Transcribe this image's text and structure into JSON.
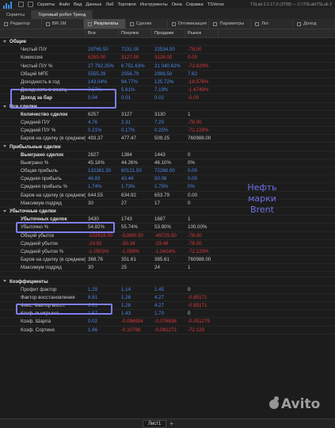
{
  "titlebar": {
    "menu": [
      "Скрипты",
      "Файл",
      "Вид",
      "Данные",
      "Лаб",
      "Торговля",
      "Инструменты",
      "Окна",
      "Справка"
    ],
    "account": "TSVerse",
    "right_text": "TSLab 2.2.17.0 (3708) — C:\\TSLab\\TSLab 2"
  },
  "tabs_top": [
    {
      "label": "Скрипты",
      "active": false
    },
    {
      "label": "Торговый робот Тренд",
      "active": true
    }
  ],
  "tabs_sub": [
    "Редактор",
    "BR:1M",
    "Результаты",
    "Сделки",
    "Оптимизация",
    "Параметры",
    "Лог",
    "Доход"
  ],
  "columns": [
    "",
    "Все",
    "Покупки",
    "Продажи",
    "Рынок"
  ],
  "rows": [
    {
      "t": "section",
      "label": "Общие"
    },
    {
      "t": "row",
      "label": "Чистый П/У",
      "v": [
        "29765.50",
        "7231.00",
        "22534.50",
        "-78.00"
      ],
      "cls": [
        "blue",
        "blue",
        "blue",
        "red"
      ]
    },
    {
      "t": "row",
      "label": "Комиссия",
      "v": [
        "6255.00",
        "3127.00",
        "3128.00",
        "0.00"
      ],
      "cls": [
        "red",
        "red",
        "red",
        "red"
      ]
    },
    {
      "t": "row",
      "label": "Чистый П/У %",
      "v": [
        "27 792.25%",
        "6 751.63%",
        "21 040.62%",
        "-72.829%"
      ],
      "cls": [
        "blue",
        "blue",
        "blue",
        "red"
      ]
    },
    {
      "t": "row",
      "label": "Общий MFE",
      "v": [
        "5555.29",
        "2556.79",
        "2998.50",
        "7.62"
      ],
      "cls": [
        "blue",
        "blue",
        "blue",
        "blue"
      ]
    },
    {
      "t": "row",
      "label": "Доходность в год",
      "v": [
        "143.04%",
        "94.77%",
        "125.72%",
        "-18.576%"
      ],
      "cls": [
        "blue",
        "blue",
        "blue",
        "red"
      ]
    },
    {
      "t": "row",
      "label": "Доходность в месяц",
      "v": [
        "7.57%",
        "5.61%",
        "7.19%",
        "-1.6749%"
      ],
      "cls": [
        "blue",
        "blue",
        "blue",
        "red"
      ]
    },
    {
      "t": "bold",
      "label": "Доход за бар",
      "v": [
        "0.04",
        "0.01",
        "0.02",
        "-0.00"
      ],
      "cls": [
        "blue",
        "blue",
        "blue",
        "red"
      ]
    },
    {
      "t": "section",
      "label": "Все сделки"
    },
    {
      "t": "bold",
      "label": "Количество сделок",
      "v": [
        "6257",
        "3127",
        "3130",
        "1"
      ],
      "cls": [
        "",
        "",
        "",
        ""
      ]
    },
    {
      "t": "row",
      "label": "Средний П/У",
      "v": [
        "4.76",
        "2.31",
        "7.20",
        "-78.00"
      ],
      "cls": [
        "blue",
        "blue",
        "blue",
        "red"
      ]
    },
    {
      "t": "row",
      "label": "Средний П/У %",
      "v": [
        "0.21%",
        "0.17%",
        "0.25%",
        "-72.129%"
      ],
      "cls": [
        "blue",
        "blue",
        "blue",
        "red"
      ]
    },
    {
      "t": "row",
      "label": "Баров на сделку (в среднем)",
      "v": [
        "493.37",
        "477.47",
        "509.25",
        "760988.00"
      ],
      "cls": [
        "",
        "",
        "",
        ""
      ]
    },
    {
      "t": "section",
      "label": "Прибыльные сделки"
    },
    {
      "t": "bold",
      "label": "Выиграно сделок",
      "v": [
        "2827",
        "1384",
        "1443",
        "0"
      ],
      "cls": [
        "",
        "",
        "",
        ""
      ]
    },
    {
      "t": "row",
      "label": "Выиграно %",
      "v": [
        "45.18%",
        "44.26%",
        "46.10%",
        "0%"
      ],
      "cls": [
        "",
        "",
        "",
        ""
      ]
    },
    {
      "t": "row",
      "label": "Общая прибыль",
      "v": [
        "132381.50",
        "60121.50",
        "72260.00",
        "0.00"
      ],
      "cls": [
        "blue",
        "blue",
        "blue",
        "blue"
      ]
    },
    {
      "t": "row",
      "label": "Средняя прибыль",
      "v": [
        "46.83",
        "43.44",
        "50.08",
        "0.00"
      ],
      "cls": [
        "blue",
        "blue",
        "blue",
        "blue"
      ]
    },
    {
      "t": "row",
      "label": "Средняя прибыль %",
      "v": [
        "1.74%",
        "1.73%",
        "1.75%",
        "0%"
      ],
      "cls": [
        "blue",
        "blue",
        "blue",
        "blue"
      ]
    },
    {
      "t": "row",
      "label": "Баров на сделку (в среднем)",
      "v": [
        "644.55",
        "634.92",
        "653.79",
        "0.00"
      ],
      "cls": [
        "",
        "",
        "",
        ""
      ]
    },
    {
      "t": "row",
      "label": "Максимум подряд",
      "v": [
        "30",
        "27",
        "17",
        "0"
      ],
      "cls": [
        "",
        "",
        "",
        ""
      ]
    },
    {
      "t": "section",
      "label": "Убыточные сделки"
    },
    {
      "t": "bold",
      "label": "Убыточных сделок",
      "v": [
        "3430",
        "1743",
        "1687",
        "1"
      ],
      "cls": [
        "",
        "",
        "",
        ""
      ]
    },
    {
      "t": "row",
      "label": "Убыточно %",
      "v": [
        "54.82%",
        "55.74%",
        "53.90%",
        "100.00%"
      ],
      "cls": [
        "",
        "",
        "",
        ""
      ]
    },
    {
      "t": "row",
      "label": "Общий убыток",
      "v": [
        "-102616.00",
        "-52890.50",
        "-49725.50",
        "-78.00"
      ],
      "cls": [
        "red",
        "red",
        "red",
        "red"
      ]
    },
    {
      "t": "row",
      "label": "Средний убыток",
      "v": [
        "-29.92",
        "-30.34",
        "-29.48",
        "-78.00"
      ],
      "cls": [
        "red",
        "red",
        "red",
        "red"
      ]
    },
    {
      "t": "row",
      "label": "Средний убыток %",
      "v": [
        "-1.0503%",
        "-1.059%",
        "-1.0414%",
        "-72.129%"
      ],
      "cls": [
        "red",
        "red",
        "red",
        "red"
      ]
    },
    {
      "t": "row",
      "label": "Баров на сделку (в среднем)",
      "v": [
        "368.76",
        "351.61",
        "385.61",
        "760988.00"
      ],
      "cls": [
        "",
        "",
        "",
        ""
      ]
    },
    {
      "t": "row",
      "label": "Максимум подряд",
      "v": [
        "30",
        "25",
        "24",
        "1"
      ],
      "cls": [
        "",
        "",
        "",
        ""
      ]
    },
    {
      "t": "gap"
    },
    {
      "t": "section",
      "label": "Коэффициенты"
    },
    {
      "t": "row",
      "label": "Профит фактор",
      "v": [
        "1.29",
        "1.14",
        "1.45",
        "0"
      ],
      "cls": [
        "blue",
        "blue",
        "blue",
        ""
      ]
    },
    {
      "t": "row",
      "label": "Фактор восстановления",
      "v": [
        "8.81",
        "1.28",
        "4.27",
        "-0.85171"
      ],
      "cls": [
        "blue",
        "blue",
        "blue",
        "red"
      ]
    },
    {
      "t": "row",
      "label": "Фикс. Фактор восст.",
      "v": [
        "8.81",
        "1.28",
        "4.27",
        "-0.85171"
      ],
      "cls": [
        "blue",
        "blue",
        "blue",
        "red"
      ]
    },
    {
      "t": "row",
      "label": "Коэф. выигрыша",
      "v": [
        "1.57",
        "1.43",
        "1.70",
        "0"
      ],
      "cls": [
        "blue",
        "blue",
        "blue",
        ""
      ]
    },
    {
      "t": "row",
      "label": "Коэф. Шарпа",
      "v": [
        "0.02",
        "-0.096954",
        "-0.076838",
        "-0.051279"
      ],
      "cls": [
        "blue",
        "red",
        "red",
        "red"
      ]
    },
    {
      "t": "row",
      "label": "Коэф. Сортино",
      "v": [
        "1.66",
        "-0.10798",
        "-0.081272",
        "-72.129"
      ],
      "cls": [
        "blue",
        "red",
        "red",
        "red"
      ]
    }
  ],
  "annotation": {
    "line1": "Нефть",
    "line2": "марки",
    "line3": "Brent"
  },
  "footer": {
    "sheet": "Лист1"
  },
  "watermark": "Avito",
  "colors": {
    "positive": "#4c8ae6",
    "negative": "#d93a3a",
    "highlight": "#7f7ff7"
  }
}
